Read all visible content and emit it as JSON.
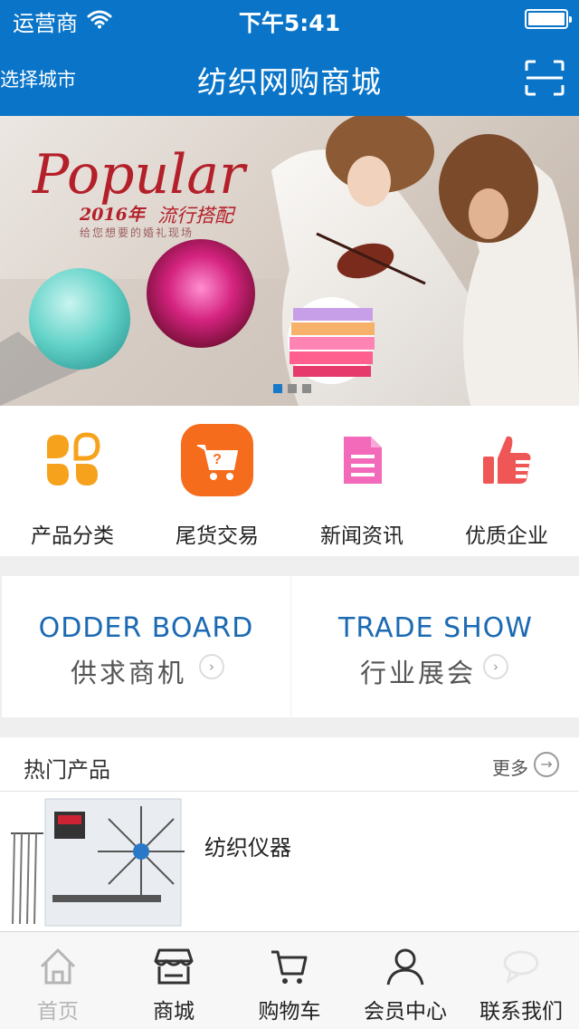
{
  "status_bar": {
    "carrier": "运营商",
    "time": "下午5:41"
  },
  "header": {
    "city": "选择城市",
    "title": "纺织网购商城",
    "scan_icon": "scan-icon"
  },
  "banner": {
    "logo_text": "Popular",
    "year_text": "2016年",
    "tagline": "流行搭配",
    "subtitle": "给您想要的婚礼现场",
    "slide_count": 3,
    "active_slide": 1
  },
  "quick_nav": [
    {
      "label": "产品分类",
      "icon": "grid-petals-icon",
      "color": "#f7a21d"
    },
    {
      "label": "尾货交易",
      "icon": "shopping-cart-icon",
      "color": "#f56c1c"
    },
    {
      "label": "新闻资讯",
      "icon": "document-icon",
      "color": "#f26ab9"
    },
    {
      "label": "优质企业",
      "icon": "thumbs-up-icon",
      "color": "#ef5656"
    }
  ],
  "promos": [
    {
      "title_en": "ODDER BOARD",
      "title_cn": "供求商机"
    },
    {
      "title_en": "TRADE SHOW",
      "title_cn": "行业展会"
    }
  ],
  "hot_products": {
    "title": "热门产品",
    "more_label": "更多",
    "items": [
      {
        "name": "纺织仪器"
      }
    ]
  },
  "tab_bar": [
    {
      "label": "首页",
      "icon": "home-icon",
      "active": true
    },
    {
      "label": "商城",
      "icon": "store-icon"
    },
    {
      "label": "购物车",
      "icon": "cart-icon"
    },
    {
      "label": "会员中心",
      "icon": "user-icon"
    },
    {
      "label": "联系我们",
      "icon": "chat-icon"
    }
  ],
  "colors": {
    "header_bg": "#0a75c8",
    "accent_blue": "#1b6ab3"
  }
}
